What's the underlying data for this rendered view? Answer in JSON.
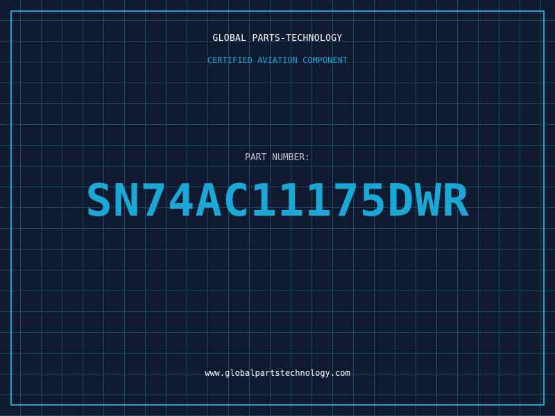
{
  "header": {
    "brand": "GLOBAL PARTS-TECHNOLOGY",
    "tagline": "CERTIFIED AVIATION COMPONENT"
  },
  "part": {
    "label": "PART NUMBER:",
    "number": "SN74AC11175DWR"
  },
  "footer": {
    "website": "www.globalpartstechnology.com"
  },
  "colors": {
    "background": "#0f1a30",
    "grid": "#1b708c",
    "accent": "#15a6cc",
    "text": "#ffffff"
  }
}
